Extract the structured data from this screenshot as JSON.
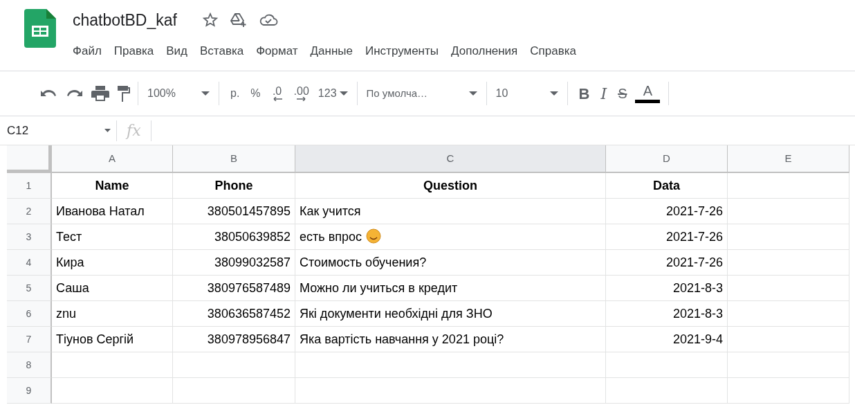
{
  "document": {
    "title": "chatbotBD_kaf"
  },
  "menu": [
    "Файл",
    "Правка",
    "Вид",
    "Вставка",
    "Формат",
    "Данные",
    "Инструменты",
    "Дополнения",
    "Справка"
  ],
  "toolbar": {
    "zoom": "100%",
    "currency": "р.",
    "percent": "%",
    "decrease_decimals": ".0",
    "increase_decimals": ".00",
    "number_format": "123",
    "font": "По умолча…",
    "font_size": "10",
    "bold": "B",
    "italic": "I",
    "strikethrough": "S",
    "text_color": "A"
  },
  "name_box": "C12",
  "formula_icon": "fx",
  "columns": [
    {
      "label": "A",
      "selected": false
    },
    {
      "label": "B",
      "selected": false
    },
    {
      "label": "C",
      "selected": true
    },
    {
      "label": "D",
      "selected": false
    },
    {
      "label": "E",
      "selected": false
    }
  ],
  "rows": [
    {
      "number": "1",
      "cells": [
        "Name",
        "Phone",
        "Question",
        "Data",
        ""
      ],
      "header": true,
      "emoji": false
    },
    {
      "number": "2",
      "cells": [
        "Иванова Натал",
        "380501457895",
        "Как учится",
        "2021-7-26",
        ""
      ],
      "header": false,
      "emoji": false
    },
    {
      "number": "3",
      "cells": [
        "Тест",
        "38050639852",
        "есть впрос",
        "2021-7-26",
        ""
      ],
      "header": false,
      "emoji": true
    },
    {
      "number": "4",
      "cells": [
        "Кира",
        "38099032587",
        "Стоимость обучения?",
        "2021-7-26",
        ""
      ],
      "header": false,
      "emoji": false
    },
    {
      "number": "5",
      "cells": [
        "Саша",
        "380976587489",
        "Можно ли учиться в кредит",
        "2021-8-3",
        ""
      ],
      "header": false,
      "emoji": false
    },
    {
      "number": "6",
      "cells": [
        "znu",
        "380636587452",
        "Які документи необхідні для ЗНО",
        "2021-8-3",
        ""
      ],
      "header": false,
      "emoji": false
    },
    {
      "number": "7",
      "cells": [
        "Тіунов Сергій",
        "380978956847",
        "Яка вартість навчання у 2021 році?",
        "2021-9-4",
        ""
      ],
      "header": false,
      "emoji": false
    },
    {
      "number": "8",
      "cells": [
        "",
        "",
        "",
        "",
        ""
      ]
    },
    {
      "number": "9",
      "cells": [
        "",
        "",
        "",
        "",
        ""
      ]
    }
  ]
}
